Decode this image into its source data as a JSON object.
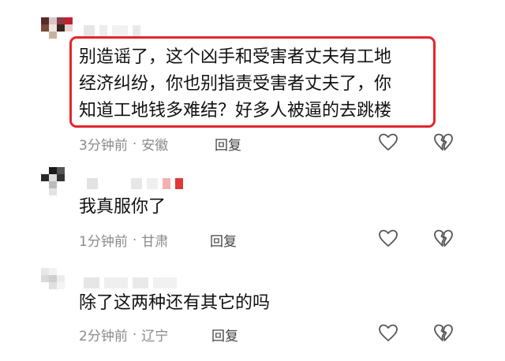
{
  "comments": [
    {
      "text_lines": [
        "别造谣了，这个凶手和受害者丈夫有工地",
        "经济纠纷，你也别指责受害者丈夫了，你",
        "知道工地钱多难结？好多人被逼的去跳楼"
      ],
      "time": "3分钟前",
      "separator": "·",
      "region": "安徽",
      "reply_label": "回复",
      "like_icon": "heart-outline-icon",
      "dislike_icon": "broken-heart-icon",
      "highlighted": true,
      "highlight_color": "#e3262b"
    },
    {
      "text_lines": [
        "我真服你了"
      ],
      "time": "1分钟前",
      "separator": "·",
      "region": "甘肃",
      "reply_label": "回复",
      "like_icon": "heart-outline-icon",
      "dislike_icon": "broken-heart-icon",
      "highlighted": false
    },
    {
      "text_lines": [
        "除了这两种还有其它的吗"
      ],
      "time": "2分钟前",
      "separator": "·",
      "region": "辽宁",
      "reply_label": "回复",
      "like_icon": "heart-outline-icon",
      "dislike_icon": "broken-heart-icon",
      "highlighted": false
    }
  ]
}
